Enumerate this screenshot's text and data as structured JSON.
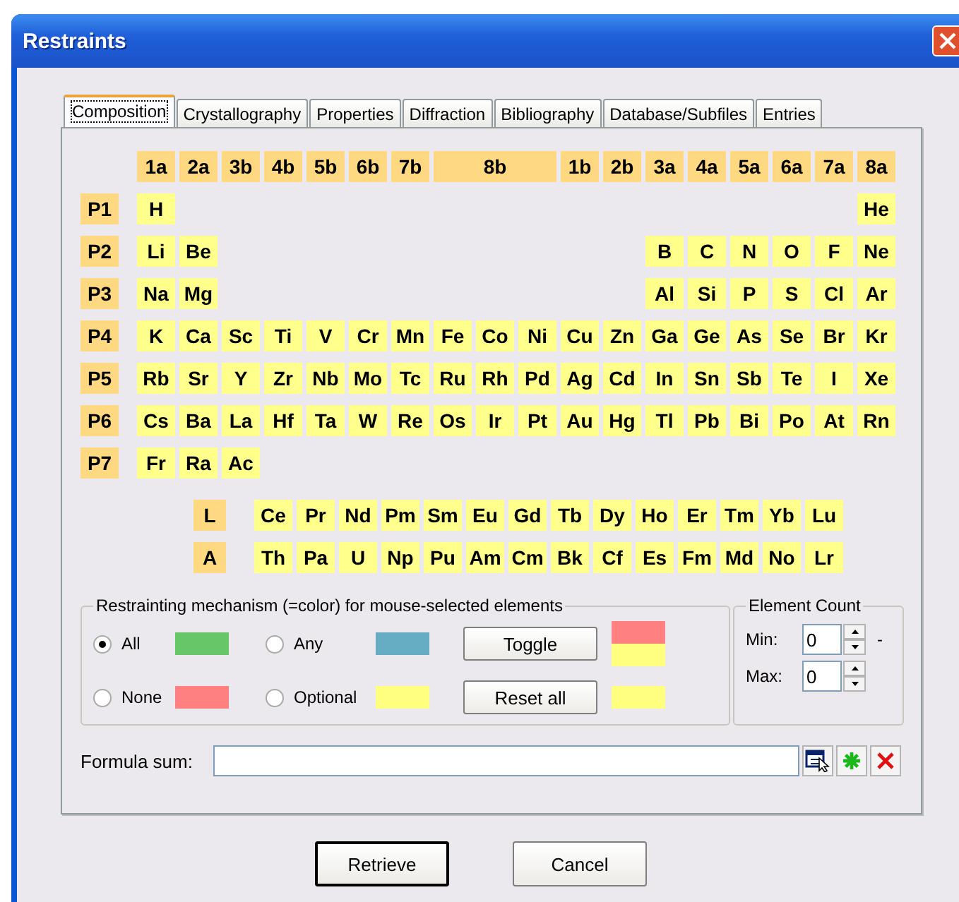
{
  "window": {
    "title": "Restraints"
  },
  "tabs": [
    {
      "label": "Composition",
      "selected": true
    },
    {
      "label": "Crystallography",
      "selected": false
    },
    {
      "label": "Properties",
      "selected": false
    },
    {
      "label": "Diffraction",
      "selected": false
    },
    {
      "label": "Bibliography",
      "selected": false
    },
    {
      "label": "Database/Subfiles",
      "selected": false
    },
    {
      "label": "Entries",
      "selected": false
    }
  ],
  "groups": [
    {
      "label": "1a",
      "kind": "single"
    },
    {
      "label": "2a",
      "kind": "single"
    },
    {
      "label": "3b",
      "kind": "single"
    },
    {
      "label": "4b",
      "kind": "single"
    },
    {
      "label": "5b",
      "kind": "single"
    },
    {
      "label": "6b",
      "kind": "single"
    },
    {
      "label": "7b",
      "kind": "single"
    },
    {
      "label": "8b",
      "kind": "triad"
    },
    {
      "label": "1b",
      "kind": "single"
    },
    {
      "label": "2b",
      "kind": "single"
    },
    {
      "label": "3a",
      "kind": "single"
    },
    {
      "label": "4a",
      "kind": "single"
    },
    {
      "label": "5a",
      "kind": "single"
    },
    {
      "label": "6a",
      "kind": "single"
    },
    {
      "label": "7a",
      "kind": "single"
    },
    {
      "label": "8a",
      "kind": "single"
    }
  ],
  "periods": [
    {
      "label": "P1",
      "s_block": [
        "H"
      ],
      "p_block": [
        "He"
      ]
    },
    {
      "label": "P2",
      "s_block": [
        "Li",
        "Be"
      ],
      "p_block": [
        "B",
        "C",
        "N",
        "O",
        "F",
        "Ne"
      ]
    },
    {
      "label": "P3",
      "s_block": [
        "Na",
        "Mg"
      ],
      "p_block": [
        "Al",
        "Si",
        "P",
        "S",
        "Cl",
        "Ar"
      ]
    },
    {
      "label": "P4",
      "s_block": [
        "K",
        "Ca"
      ],
      "d_block": [
        "Sc",
        "Ti",
        "V",
        "Cr",
        "Mn",
        "Fe",
        "Co",
        "Ni",
        "Cu",
        "Zn"
      ],
      "p_block": [
        "Ga",
        "Ge",
        "As",
        "Se",
        "Br",
        "Kr"
      ]
    },
    {
      "label": "P5",
      "s_block": [
        "Rb",
        "Sr"
      ],
      "d_block": [
        "Y",
        "Zr",
        "Nb",
        "Mo",
        "Tc",
        "Ru",
        "Rh",
        "Pd",
        "Ag",
        "Cd"
      ],
      "p_block": [
        "In",
        "Sn",
        "Sb",
        "Te",
        "I",
        "Xe"
      ]
    },
    {
      "label": "P6",
      "s_block": [
        "Cs",
        "Ba"
      ],
      "d_block": [
        "La",
        "Hf",
        "Ta",
        "W",
        "Re",
        "Os",
        "Ir",
        "Pt",
        "Au",
        "Hg"
      ],
      "p_block": [
        "Tl",
        "Pb",
        "Bi",
        "Po",
        "At",
        "Rn"
      ]
    },
    {
      "label": "P7",
      "s_block": [
        "Fr",
        "Ra"
      ],
      "d_block": [
        "Ac"
      ]
    }
  ],
  "f_series": [
    {
      "label": "L",
      "elements": [
        "Ce",
        "Pr",
        "Nd",
        "Pm",
        "Sm",
        "Eu",
        "Gd",
        "Tb",
        "Dy",
        "Ho",
        "Er",
        "Tm",
        "Yb",
        "Lu"
      ]
    },
    {
      "label": "A",
      "elements": [
        "Th",
        "Pa",
        "U",
        "Np",
        "Pu",
        "Am",
        "Cm",
        "Bk",
        "Cf",
        "Es",
        "Fm",
        "Md",
        "No",
        "Lr"
      ]
    }
  ],
  "mechanism": {
    "title": "Restrainting mechanism (=color) for mouse-selected elements",
    "options": [
      {
        "label": "All",
        "selected": true,
        "color": "#66c766"
      },
      {
        "label": "Any",
        "selected": false,
        "color": "#66adc4"
      },
      {
        "label": "None",
        "selected": false,
        "color": "#ff8080"
      },
      {
        "label": "Optional",
        "selected": false,
        "color": "#ffff80"
      }
    ],
    "toggle": {
      "label": "Toggle",
      "swatches": [
        {
          "color": "#ff8080"
        },
        {
          "color": "#ffff80"
        }
      ]
    },
    "reset": {
      "label": "Reset all",
      "color": "#ffff80"
    }
  },
  "element_count": {
    "title": "Element Count",
    "min": {
      "label": "Min:",
      "value": "0"
    },
    "separator": "-",
    "max": {
      "label": "Max:",
      "value": "0"
    }
  },
  "formula": {
    "label": "Formula sum:"
  },
  "buttons": [
    {
      "label": "Retrieve",
      "kind": "default"
    },
    {
      "label": "Cancel",
      "kind": "normal"
    }
  ]
}
